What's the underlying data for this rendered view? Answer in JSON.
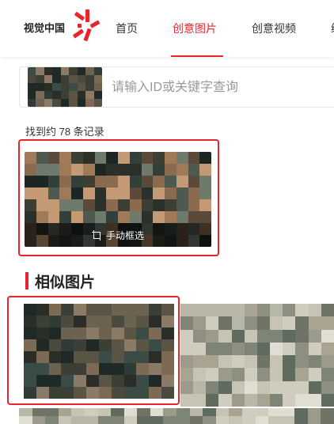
{
  "header": {
    "logo_text": "视觉中国",
    "nav": [
      {
        "label": "首页",
        "active": false
      },
      {
        "label": "创意图片",
        "active": true
      },
      {
        "label": "创意视频",
        "active": false
      },
      {
        "label": "编",
        "active": false
      }
    ]
  },
  "search": {
    "placeholder": "请输入ID或关键字查询"
  },
  "results": {
    "count_text": "找到约 78 条记录"
  },
  "query_image": {
    "crop_label": "手动框选"
  },
  "similar": {
    "title": "相似图片"
  },
  "colors": {
    "accent": "#e8242c"
  }
}
